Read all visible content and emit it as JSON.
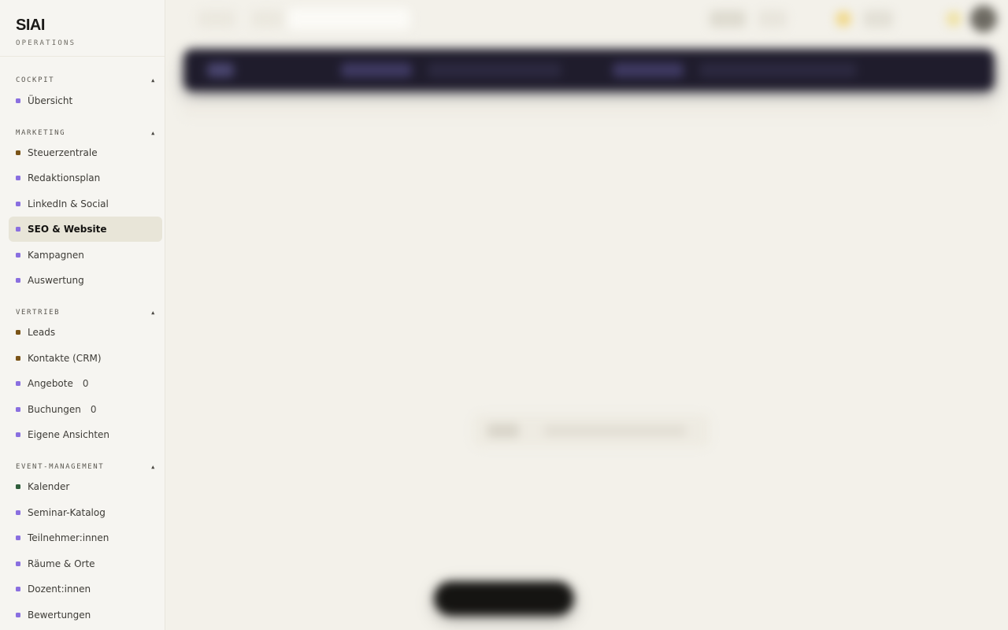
{
  "brand": {
    "title": "SIAI",
    "subtitle": "OPERATIONS"
  },
  "sections": [
    {
      "heading": "COCKPIT",
      "items": [
        {
          "label": "Übersicht"
        }
      ]
    },
    {
      "heading": "MARKETING",
      "items": [
        {
          "label": "Steuerzentrale"
        },
        {
          "label": "Redaktionsplan"
        },
        {
          "label": "LinkedIn & Social"
        },
        {
          "label": "SEO & Website",
          "active": true
        },
        {
          "label": "Kampagnen"
        },
        {
          "label": "Auswertung"
        }
      ]
    },
    {
      "heading": "VERTRIEB",
      "items": [
        {
          "label": "Leads"
        },
        {
          "label": "Kontakte (CRM)"
        },
        {
          "label": "Angebote",
          "count": "0"
        },
        {
          "label": "Buchungen",
          "count": "0"
        },
        {
          "label": "Eigene Ansichten"
        }
      ]
    },
    {
      "heading": "EVENT-MANAGEMENT",
      "items": [
        {
          "label": "Kalender"
        },
        {
          "label": "Seminar-Katalog"
        },
        {
          "label": "Teilnehmer:innen"
        },
        {
          "label": "Räume & Orte"
        },
        {
          "label": "Dozent:innen"
        },
        {
          "label": "Bewertungen"
        }
      ]
    }
  ],
  "section_toggle_glyph": "▲",
  "colors": {
    "purple": "#8a6fe0",
    "brown": "#7a5418",
    "green": "#2f5e3c",
    "banner": "#1f1c2c",
    "active_bg": "#e8e5d8"
  },
  "icons": {
    "section_toggle": "chevron-up-icon",
    "nav_dot": "square-dot-icon"
  }
}
